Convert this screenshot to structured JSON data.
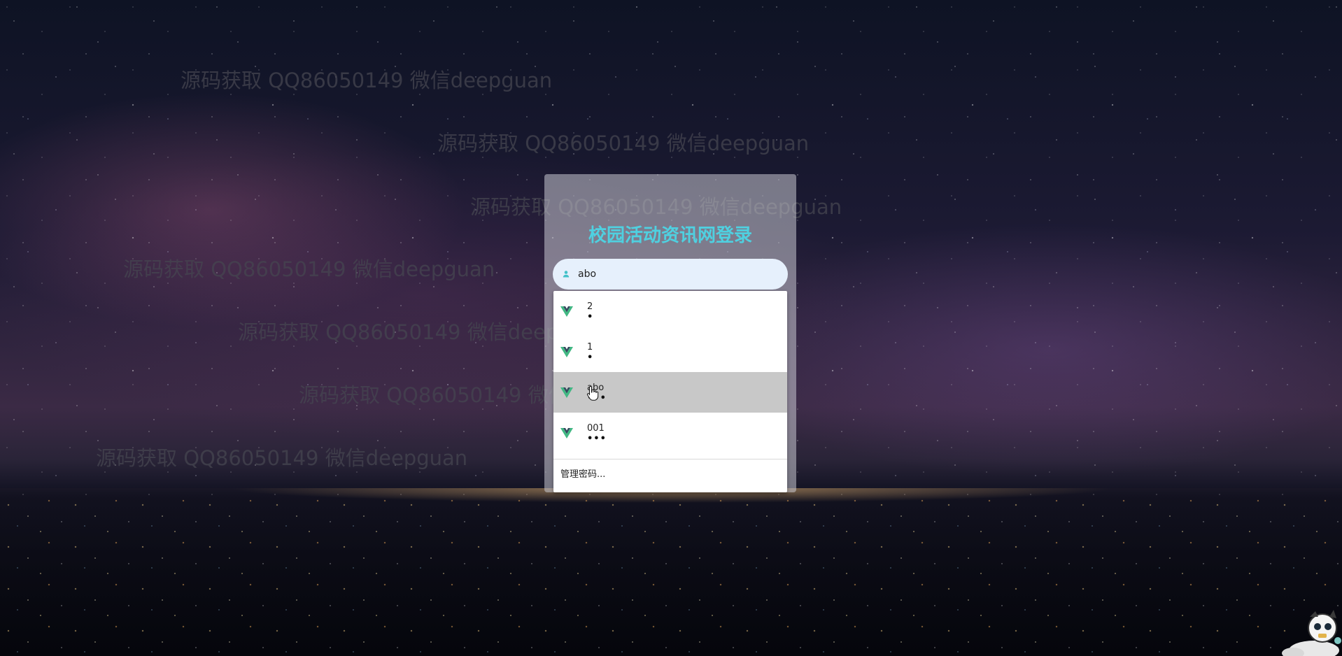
{
  "watermark_text": "源码获取 QQ86050149 微信deepguan",
  "watermarks": [
    {
      "text": "源码获取 QQ86050149 微信deepguan"
    },
    {
      "text": "源码获取 QQ86050149 微信deepguan"
    },
    {
      "text": "源码获取 QQ86050149 微信deepguan"
    },
    {
      "text": "源码获取 QQ86050149 微信deepguan"
    },
    {
      "text": "源码获取 QQ86050149 微信deepguan"
    },
    {
      "text": "源码获取 QQ86050149 微信deepguan"
    },
    {
      "text": "源码获取 QQ86050149 微信deepguan"
    }
  ],
  "login": {
    "title": "校园活动资讯网登录",
    "username_value": "abo",
    "title_color": "#4fd0e0"
  },
  "autofill": {
    "items": [
      {
        "username": "2",
        "password_mask": "•"
      },
      {
        "username": "1",
        "password_mask": "•"
      },
      {
        "username": "abo",
        "password_mask": "•••"
      },
      {
        "username": "001",
        "password_mask": "•••"
      }
    ],
    "manage_label": "管理密码..."
  }
}
